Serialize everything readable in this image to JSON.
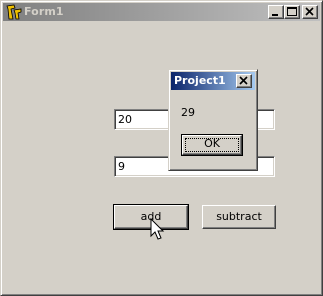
{
  "window": {
    "title": "Form1",
    "icons": {
      "app": "delphi-app-icon",
      "minimize": "minimize-icon",
      "maximize": "maximize-icon",
      "close": "close-icon"
    },
    "colors": {
      "titlebar_start": "#808080",
      "titlebar_end": "#c0c0c0",
      "face": "#d4d0c8"
    }
  },
  "form": {
    "edit1_value": "20",
    "edit2_value": "9",
    "add_label": "add",
    "subtract_label": "subtract"
  },
  "dialog": {
    "title": "Project1",
    "message": "29",
    "ok_label": "OK",
    "icons": {
      "close": "close-icon"
    },
    "colors": {
      "titlebar_start": "#0a246a",
      "titlebar_end": "#a6caf0"
    }
  },
  "cursor": {
    "icon": "arrow-cursor-icon"
  }
}
